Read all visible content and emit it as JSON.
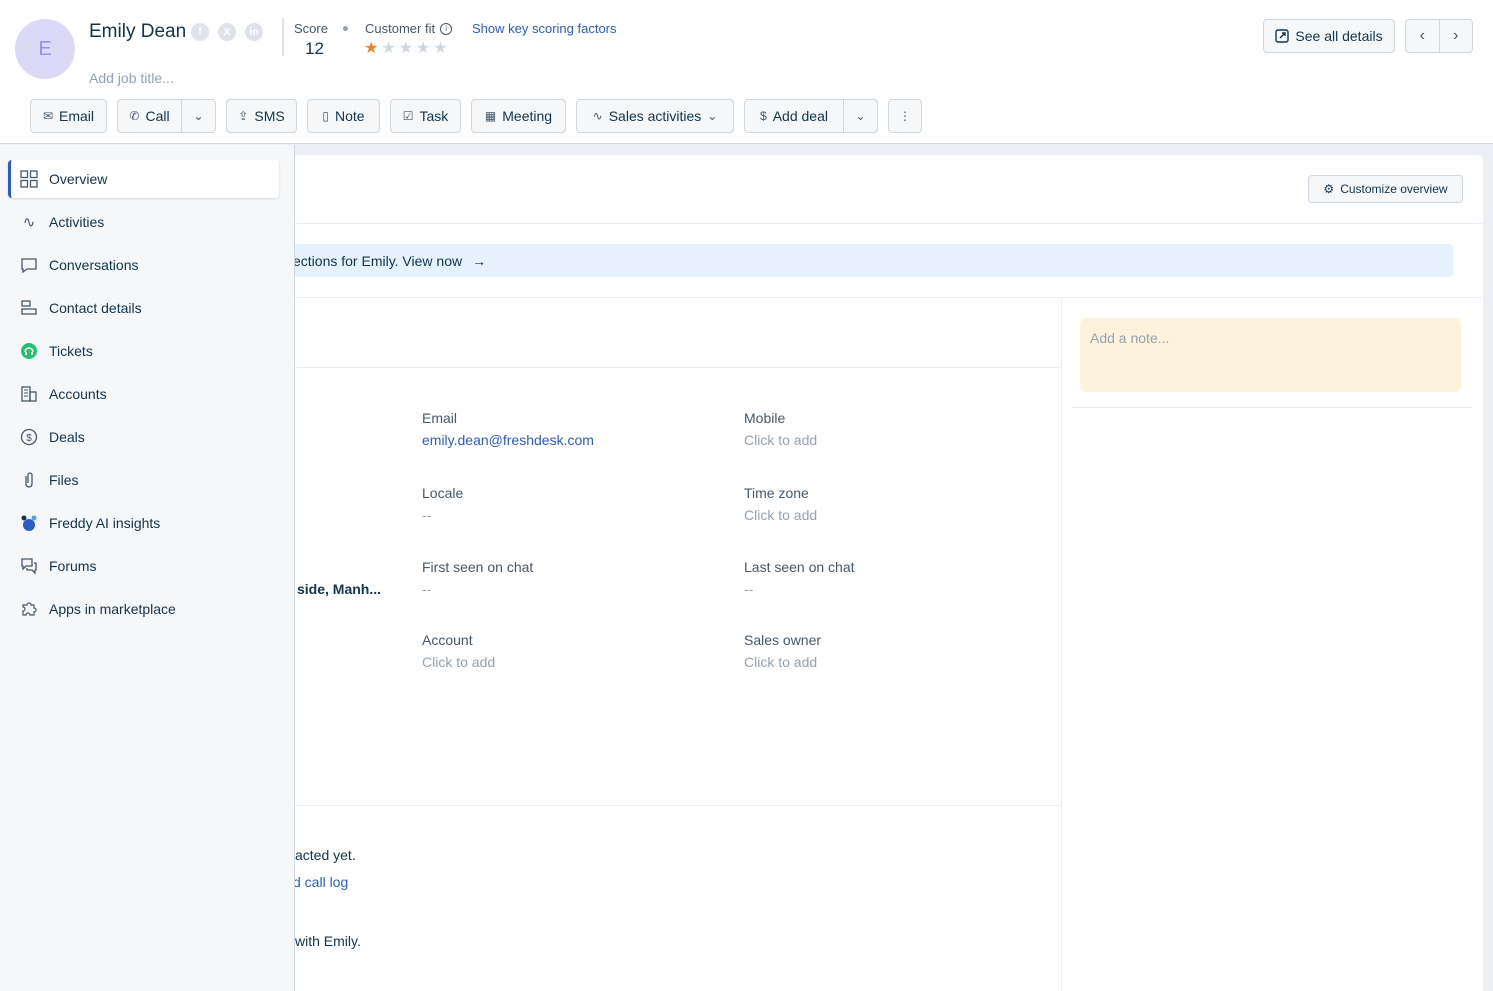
{
  "contact": {
    "avatar_letter": "E",
    "name": "Emily Dean",
    "job_title_placeholder": "Add job title...",
    "score_label": "Score",
    "score_value": "12",
    "customer_fit_label": "Customer fit",
    "customer_fit_rating": 1,
    "customer_fit_max": 5,
    "key_factors_link": "Show key scoring factors",
    "see_all_details": "See all details"
  },
  "actions": {
    "email": "Email",
    "call": "Call",
    "sms": "SMS",
    "note": "Note",
    "task": "Task",
    "meeting": "Meeting",
    "sales_activities": "Sales activities",
    "add_deal": "Add deal"
  },
  "sidebar": {
    "items": [
      {
        "label": "Overview",
        "icon": "grid-icon"
      },
      {
        "label": "Activities",
        "icon": "activity-icon"
      },
      {
        "label": "Conversations",
        "icon": "chat-icon"
      },
      {
        "label": "Contact details",
        "icon": "details-icon"
      },
      {
        "label": "Tickets",
        "icon": "freshdesk-icon"
      },
      {
        "label": "Accounts",
        "icon": "building-icon"
      },
      {
        "label": "Deals",
        "icon": "dollar-icon"
      },
      {
        "label": "Files",
        "icon": "paperclip-icon"
      },
      {
        "label": "Freddy AI insights",
        "icon": "freddy-icon"
      },
      {
        "label": "Forums",
        "icon": "forum-icon"
      },
      {
        "label": "Apps in marketplace",
        "icon": "puzzle-icon"
      }
    ]
  },
  "overview": {
    "customize_button": "Customize overview",
    "banner_text": "ections for Emily. View now",
    "note_placeholder": "Add a note...",
    "fields": {
      "email": {
        "label": "Email",
        "value": "emily.dean@freshdesk.com"
      },
      "mobile": {
        "label": "Mobile",
        "value": "Click to add"
      },
      "locale": {
        "label": "Locale",
        "value": "--"
      },
      "timezone": {
        "label": "Time zone",
        "value": "Click to add"
      },
      "first_seen": {
        "label": "First seen on chat",
        "value": "--"
      },
      "last_seen": {
        "label": "Last seen on chat",
        "value": "--"
      },
      "account": {
        "label": "Account",
        "value": "Click to add"
      },
      "sales_owner": {
        "label": "Sales owner",
        "value": "Click to add"
      }
    },
    "address_fragment": "side, Manh...",
    "fragment_contacted": "acted yet.",
    "fragment_call_log": "d call log",
    "fragment_with": "with Emily."
  }
}
